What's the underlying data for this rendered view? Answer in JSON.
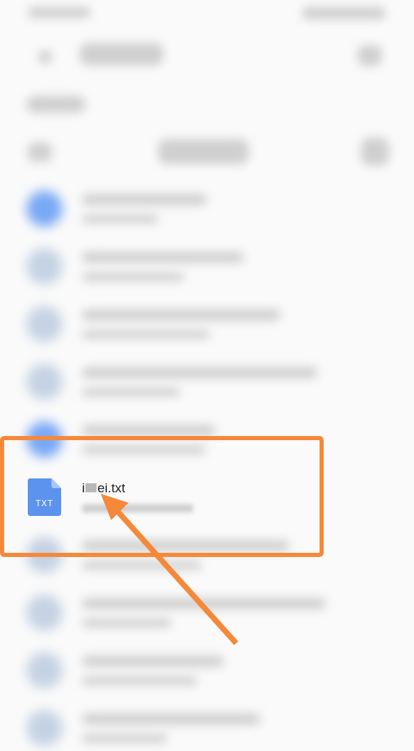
{
  "files": [
    {
      "kind": "folder",
      "highlighted": false
    },
    {
      "kind": "file",
      "highlighted": false
    },
    {
      "kind": "file",
      "highlighted": false
    },
    {
      "kind": "file",
      "highlighted": false
    },
    {
      "kind": "folder",
      "highlighted": false
    },
    {
      "kind": "txt",
      "highlighted": true,
      "type_label": "TXT",
      "name_parts": [
        {
          "kind": "text",
          "text": "i"
        },
        {
          "kind": "redaction"
        },
        {
          "kind": "text",
          "text": "ei.txt"
        }
      ]
    },
    {
      "kind": "file",
      "highlighted": false
    },
    {
      "kind": "file",
      "highlighted": false
    },
    {
      "kind": "file",
      "highlighted": false
    },
    {
      "kind": "file",
      "highlighted": false
    }
  ],
  "annotation": {
    "color": "#f5893a"
  }
}
